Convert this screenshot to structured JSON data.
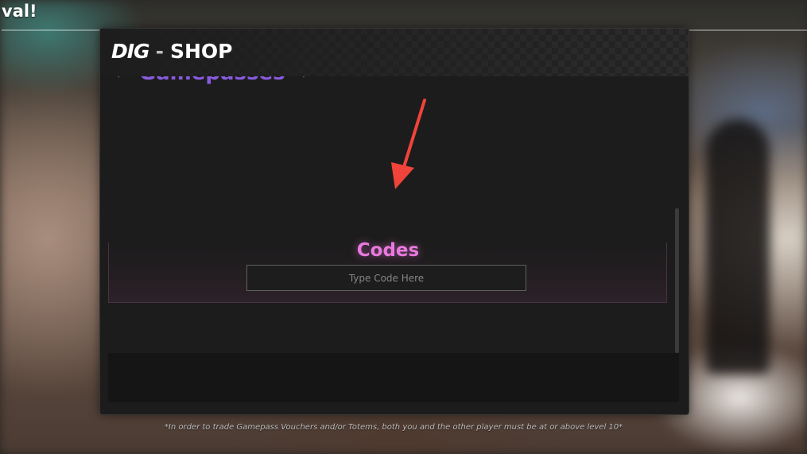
{
  "hud": {
    "top_left_text": "val!"
  },
  "shop": {
    "logo": "DIG",
    "separator": "-",
    "title": "SHOP",
    "section_heading": "Gamepasses",
    "codes": {
      "title": "Codes",
      "input_placeholder": "Type Code Here",
      "input_value": ""
    },
    "footnote": "*In order to trade Gamepass Vouchers and/or Totems, both you and the other player must be at or above level 10*"
  },
  "colors": {
    "accent_purple": "#8a5be0",
    "codes_pink": "#e979de",
    "annotation_arrow": "#f0443a",
    "panel_bg": "#1c1c1c"
  },
  "icons": {
    "section_markers": "triangle-down",
    "annotation": "red-arrow"
  }
}
